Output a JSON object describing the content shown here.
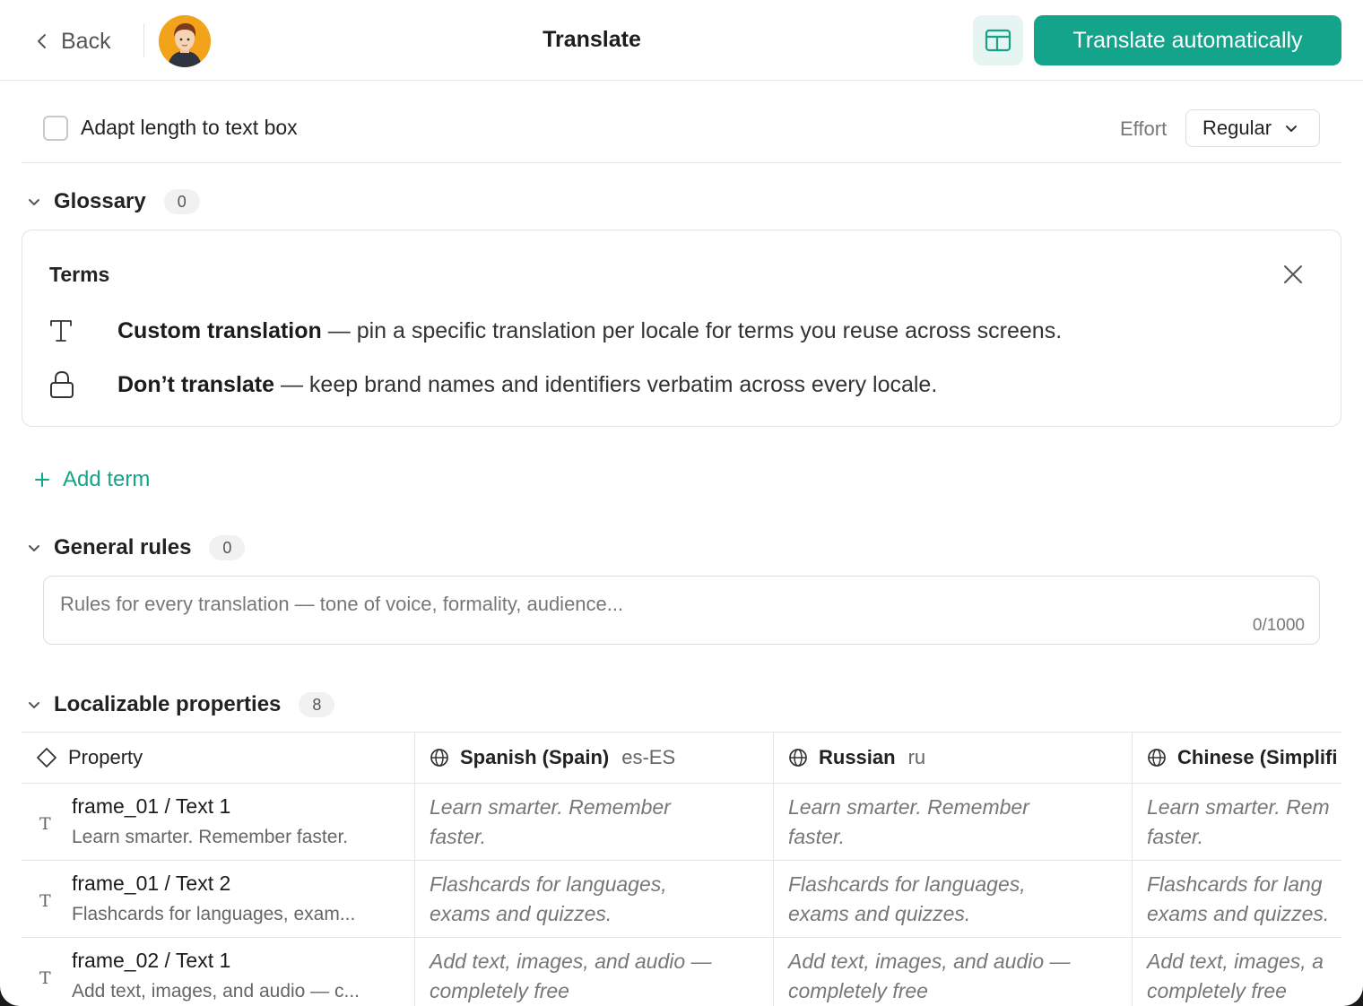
{
  "header": {
    "back_label": "Back",
    "title": "Translate",
    "primary_action": "Translate automatically"
  },
  "options": {
    "adapt_length_label": "Adapt length to text box",
    "adapt_length_checked": false,
    "effort_label": "Effort",
    "effort_value": "Regular"
  },
  "glossary": {
    "title": "Glossary",
    "count": "0",
    "terms_card": {
      "title": "Terms",
      "items": [
        {
          "icon": "text-icon",
          "bold": "Custom translation",
          "text": " — pin a specific translation per locale for terms you reuse across screens."
        },
        {
          "icon": "lock-icon",
          "bold": "Don’t translate",
          "text": " — keep brand names and identifiers verbatim across every locale."
        }
      ]
    },
    "add_term_label": "Add term"
  },
  "general_rules": {
    "title": "General rules",
    "count": "0",
    "placeholder": "Rules for every translation — tone of voice, formality, audience...",
    "counter": "0/1000"
  },
  "localizable": {
    "title": "Localizable properties",
    "count": "8",
    "property_header": "Property",
    "locales": [
      {
        "name": "Spanish (Spain)",
        "code": "es-ES"
      },
      {
        "name": "Russian",
        "code": "ru"
      },
      {
        "name": "Chinese (Simplifi",
        "code": ""
      }
    ],
    "rows": [
      {
        "name": "frame_01 / Text 1",
        "source": "Learn smarter. Remember faster.",
        "translations": [
          "Learn smarter. Remember faster.",
          "Learn smarter. Remember faster.",
          "Learn smarter. Rem faster."
        ]
      },
      {
        "name": "frame_01 / Text 2",
        "source": "Flashcards for languages, exam...",
        "translations": [
          "Flashcards for languages, exams and quizzes.",
          "Flashcards for languages, exams and quizzes.",
          "Flashcards for lang exams and quizzes."
        ]
      },
      {
        "name": "frame_02 / Text 1",
        "source": "Add text, images, and audio — c...",
        "translations": [
          "Add text, images, and audio — completely free",
          "Add text, images, and audio — completely free",
          "Add text, images, a completely free"
        ]
      }
    ]
  },
  "colors": {
    "accent": "#14a38b",
    "accent_soft": "#e6f5f2"
  }
}
